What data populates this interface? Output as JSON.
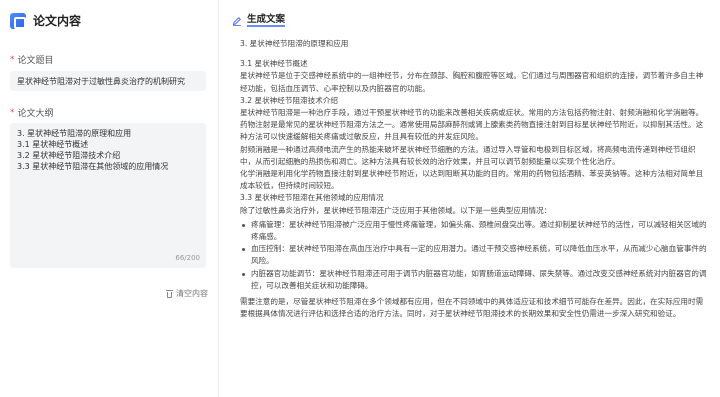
{
  "app": {
    "title": "论文内容"
  },
  "left": {
    "title_label": "论文题目",
    "title_value": "星状神经节阻滞对于过敏性鼻炎治疗的机制研究",
    "outline_label": "论文大纲",
    "outline_lines": [
      "3. 星状神经节阻滞的原理和应用",
      "3.1 星状神经节概述",
      "3.2 星状神经节阻滞技术介绍",
      "3.3 星状神经节阻滞在其他领域的应用情况"
    ],
    "counter": "66/200",
    "clear_label": "清空内容"
  },
  "right": {
    "header": "生成文案",
    "paragraphs": [
      "3. 星状神经节阻滞的原理和应用",
      "3.1 星状神经节概述",
      "星状神经节是位于交感神经系统中的一组神经节，分布在颈部、胸腔和腹腔等区域。它们通过与周围器官和组织的连接，调节着许多自主神经功能，包括血压调节、心率控制以及内脏器官的功能。",
      "3.2 星状神经节阻滞技术介绍",
      "星状神经节阻滞是一种治疗手段，通过干预星状神经节的功能来改善相关疾病或症状。常用的方法包括药物注射、射频消融和化学消融等。",
      "药物注射是最常见的星状神经节阻滞方法之一。通常使用局部麻醉剂或肾上腺素类药物直接注射到目标星状神经节附近，以抑制其活性。这种方法可以快速缓解相关疼痛或过敏反应，并且具有较低的并发症风险。",
      "射频消融是一种通过高频电流产生的热能来破坏星状神经节细胞的方法。通过导入导管和电极到目标区域，将高频电流传递到神经节组织中，从而引起细胞的热损伤和凋亡。这种方法具有较长效的治疗效果，并且可以调节射频能量以实现个性化治疗。",
      "化学消融是利用化学药物直接注射到星状神经节附近，以达到阻断其功能的目的。常用的药物包括酒精、苯妥英钠等。这种方法相对简单且成本较低，但持续时间较短。",
      "3.3 星状神经节阻滞在其他领域的应用情况",
      "除了过敏性鼻炎治疗外，星状神经节阻滞还广泛应用于其他领域。以下是一些典型应用情况："
    ],
    "bullets": [
      "疼痛管理：星状神经节阻滞被广泛应用于慢性疼痛管理，如偏头痛、颈椎间盘突出等。通过抑制星状神经节的活性，可以减轻相关区域的疼痛感。",
      "血压控制：星状神经节阻滞在高血压治疗中具有一定的应用潜力。通过干预交感神经系统，可以降低血压水平，从而减少心脑血管事件的风险。",
      "内脏器官功能调节：星状神经节阻滞还可用于调节内脏器官功能，如胃肠道运动障碍、尿失禁等。通过改变交感神经系统对内脏器官的调控，可以改善相关症状和功能障碍。"
    ],
    "closing": "需要注意的是，尽管星状神经节阻滞在多个领域都有应用，但在不同领域中的具体适应证和技术细节可能存在差异。因此，在实际应用时需要根据具体情况进行评估和选择合适的治疗方法。同时，对于星状神经节阻滞技术的长期效果和安全性仍需进一步深入研究和验证。"
  }
}
